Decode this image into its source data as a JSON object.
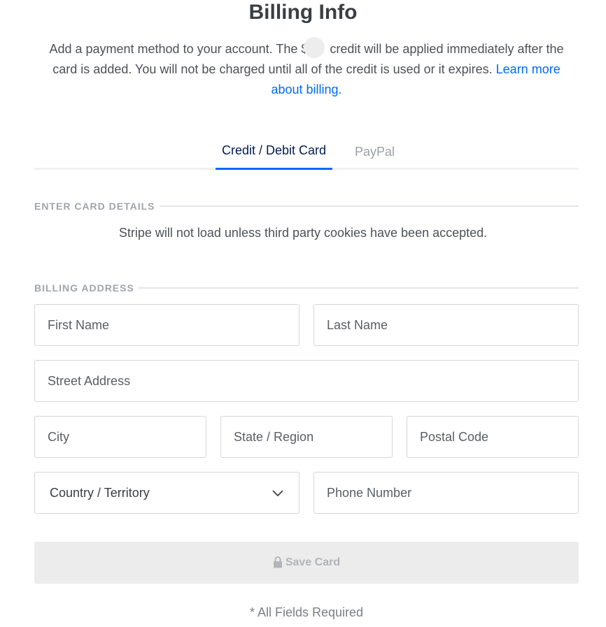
{
  "header": {
    "title": "Billing Info",
    "intro_part1": "Add a payment method to your account. The $",
    "intro_part2": " credit will be applied immediately after the card is added. You will not be charged until all of the credit is used or it expires. ",
    "learn_more_link": "Learn more about billing."
  },
  "tabs": [
    {
      "label": "Credit / Debit Card",
      "active": true
    },
    {
      "label": "PayPal",
      "active": false
    }
  ],
  "card_section": {
    "label": "ENTER CARD DETAILS",
    "notice": "Stripe will not load unless third party cookies have been accepted."
  },
  "billing_section": {
    "label": "BILLING ADDRESS",
    "fields": {
      "first_name": {
        "placeholder": "First Name",
        "value": ""
      },
      "last_name": {
        "placeholder": "Last Name",
        "value": ""
      },
      "street_address": {
        "placeholder": "Street Address",
        "value": ""
      },
      "city": {
        "placeholder": "City",
        "value": ""
      },
      "state_region": {
        "placeholder": "State / Region",
        "value": ""
      },
      "postal_code": {
        "placeholder": "Postal Code",
        "value": ""
      },
      "country": {
        "selected": "Country / Territory"
      },
      "phone_number": {
        "placeholder": "Phone Number",
        "value": ""
      }
    }
  },
  "actions": {
    "save_label": "Save Card",
    "save_disabled": true
  },
  "footer": {
    "required_note": "* All Fields Required"
  },
  "colors": {
    "accent": "#0069ff",
    "tab_active_text": "#031b4e",
    "button_disabled_bg": "#ececec"
  },
  "icons": {
    "select": "chevron-down-icon",
    "save": "lock-icon"
  }
}
